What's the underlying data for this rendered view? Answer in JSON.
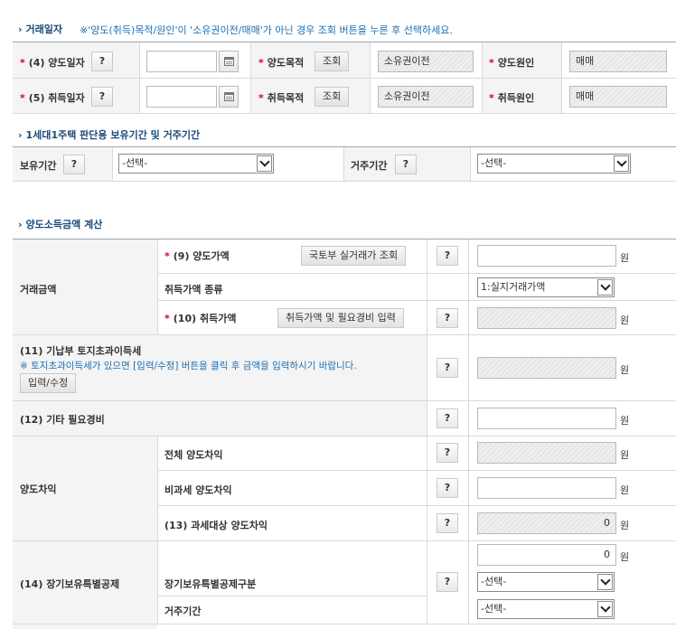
{
  "section1": {
    "title": "거래일자",
    "notice": "※'양도(취득)목적/원인'이 '소유권이전/매매'가 아닌 경우 조회 버튼을 누른 후 선택하세요.",
    "row1": {
      "date_label": "(4) 양도일자",
      "purpose_label": "양도목적",
      "lookup_label": "조회",
      "purpose_value": "소유권이전",
      "cause_label": "양도원인",
      "cause_value": "매매"
    },
    "row2": {
      "date_label": "(5) 취득일자",
      "purpose_label": "취득목적",
      "lookup_label": "조회",
      "purpose_value": "소유권이전",
      "cause_label": "취득원인",
      "cause_value": "매매"
    }
  },
  "section2": {
    "title": "1세대1주택 판단용 보유기간 및 거주기간",
    "hold_label": "보유기간",
    "hold_select": "-선택-",
    "reside_label": "거주기간",
    "reside_select": "-선택-"
  },
  "section3": {
    "title": "양도소득금액 계산",
    "help": "?",
    "won": "원",
    "trade_amount_label": "거래금액",
    "sale_price_label": "(9) 양도가액",
    "molit_lookup_label": "국토부 실거래가 조회",
    "acq_type_label": "취득가액 종류",
    "acq_type_value": "1:실지거래가액",
    "acq_price_label": "(10) 취득가액",
    "acq_input_label": "취득가액 및 필요경비 입력",
    "land_tax_label": "(11) 기납부 토지초과이득세",
    "land_tax_notice": "※ 토지초과이득세가 있으면 [입력/수정] 버튼을 클릭 후 금액을 입력하시기 바랍니다.",
    "land_tax_button": "입력/수정",
    "other_expense_label": "(12) 기타 필요경비",
    "gain_label": "양도차익",
    "total_gain_label": "전체 양도차익",
    "nontax_gain_label": "비과세 양도차익",
    "taxable_gain_label": "(13) 과세대상 양도차익",
    "taxable_gain_value": "0",
    "ltd_label": "(14) 장기보유특별공제",
    "ltd_value": "0",
    "ltd_type_label": "장기보유특별공제구분",
    "ltd_type_value": "-선택-",
    "ltd_reside_label": "거주기간",
    "ltd_reside_value": "-선택-"
  },
  "icons": {
    "calendar": "calendar-icon",
    "arrow": "chevron-right-icon",
    "dropdown": "chevron-down-icon"
  },
  "colors": {
    "section_title": "#1a4a7a",
    "notice": "#1a6fb3",
    "required_star": "#d0021b"
  }
}
